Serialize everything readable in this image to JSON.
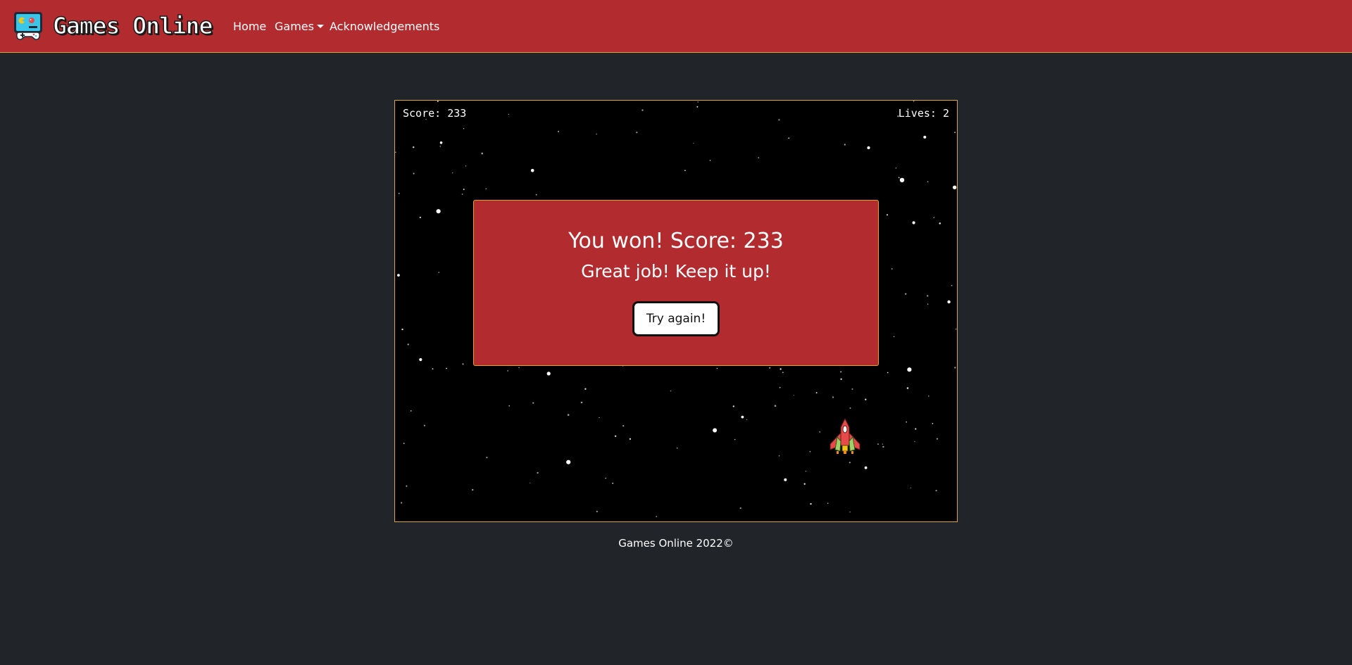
{
  "navbar": {
    "brand": "Games Online",
    "links": {
      "home": "Home",
      "games": "Games",
      "acknowledgements": "Acknowledgements"
    },
    "logo_icon": "gamepad-screen-icon",
    "background_color": "#b22b2f",
    "border_color": "#e0a23a"
  },
  "game": {
    "hud": {
      "score": "Score: 233",
      "lives": "Lives: 2"
    },
    "dialog": {
      "title": "You won! Score: 233",
      "subtitle": "Great job! Keep it up!",
      "button_label": "Try again!"
    },
    "player_icon": "spaceship-icon",
    "background_color": "#000000",
    "frame_border_color": "#e0a23a"
  },
  "footer": {
    "text": "Games Online 2022©"
  },
  "page_background_color": "#212529"
}
